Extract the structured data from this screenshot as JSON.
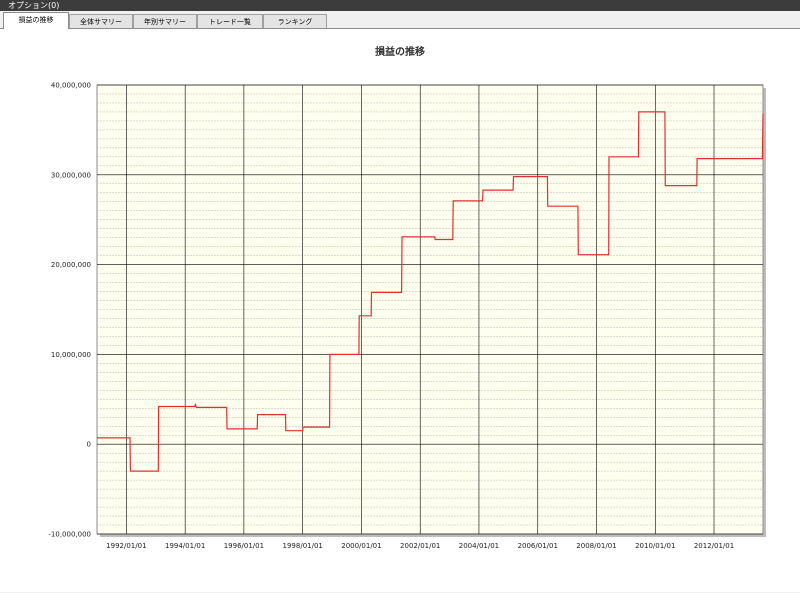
{
  "menubar": {
    "options_label": "オプション(0)"
  },
  "tabs": [
    {
      "label": "損益の推移",
      "active": true
    },
    {
      "label": "全体サマリー",
      "active": false
    },
    {
      "label": "年別サマリー",
      "active": false
    },
    {
      "label": "トレード一覧",
      "active": false
    },
    {
      "label": "ランキング",
      "active": false
    }
  ],
  "colors": {
    "series": "#e03030",
    "plot_bg": "#fffff0",
    "grid_major": "#000000",
    "grid_minor": "#b8b8b8"
  },
  "chart_data": {
    "type": "line",
    "title": "損益の推移",
    "xlabel": "",
    "ylabel": "",
    "ylim": [
      -10000000,
      40000000
    ],
    "xlim": [
      "1991/01/01",
      "2013/09/01"
    ],
    "x_tick_labels": [
      "1992/01/01",
      "1994/01/01",
      "1996/01/01",
      "1998/01/01",
      "2000/01/01",
      "2002/01/01",
      "2004/01/01",
      "2006/01/01",
      "2008/01/01",
      "2010/01/01",
      "2012/01/01"
    ],
    "y_tick_labels": [
      "40,000,000",
      "30,000,000",
      "20,000,000",
      "10,000,000",
      "0",
      "-10,000,000"
    ],
    "y_tick_values": [
      40000000,
      30000000,
      20000000,
      10000000,
      0,
      -10000000
    ],
    "series": [
      {
        "x": [
          "1991/01/01",
          "1992/02/15",
          "1992/02/20",
          "1993/02/01",
          "1993/02/05",
          "1994/05/01",
          "1994/05/10",
          "1994/05/15",
          "1994/05/20",
          "1995/06/01",
          "1995/06/05",
          "1996/06/15",
          "1996/06/20",
          "1997/06/01",
          "1997/06/05",
          "1998/01/01",
          "1998/01/05",
          "1998/12/01",
          "1998/12/05",
          "1999/12/01",
          "1999/12/05",
          "2000/05/01",
          "2000/05/05",
          "2001/05/15",
          "2001/05/20",
          "2002/07/01",
          "2002/07/05",
          "2003/02/10",
          "2003/02/15",
          "2004/02/15",
          "2004/02/20",
          "2005/03/01",
          "2005/03/05",
          "2006/05/01",
          "2006/05/05",
          "2007/05/15",
          "2007/05/20",
          "2008/06/01",
          "2008/06/05",
          "2009/06/05",
          "2009/06/10",
          "2010/05/01",
          "2010/05/05",
          "2011/06/01",
          "2011/06/05",
          "2012/05/15",
          "2012/05/20",
          "2013/08/25",
          "2013/09/01"
        ],
        "values": [
          700000,
          700000,
          -3000000,
          -3000000,
          4200000,
          4200000,
          4500000,
          4200000,
          4100000,
          4100000,
          1700000,
          1700000,
          3300000,
          3300000,
          1500000,
          1500000,
          1900000,
          1900000,
          10000000,
          10000000,
          14300000,
          14300000,
          16900000,
          16900000,
          23100000,
          23100000,
          22800000,
          22800000,
          27100000,
          27100000,
          28300000,
          28300000,
          29800000,
          29800000,
          26500000,
          26500000,
          21100000,
          21100000,
          32000000,
          32000000,
          37000000,
          37000000,
          28800000,
          28800000,
          31800000,
          31800000,
          31800000,
          31800000,
          36800000
        ]
      }
    ]
  }
}
